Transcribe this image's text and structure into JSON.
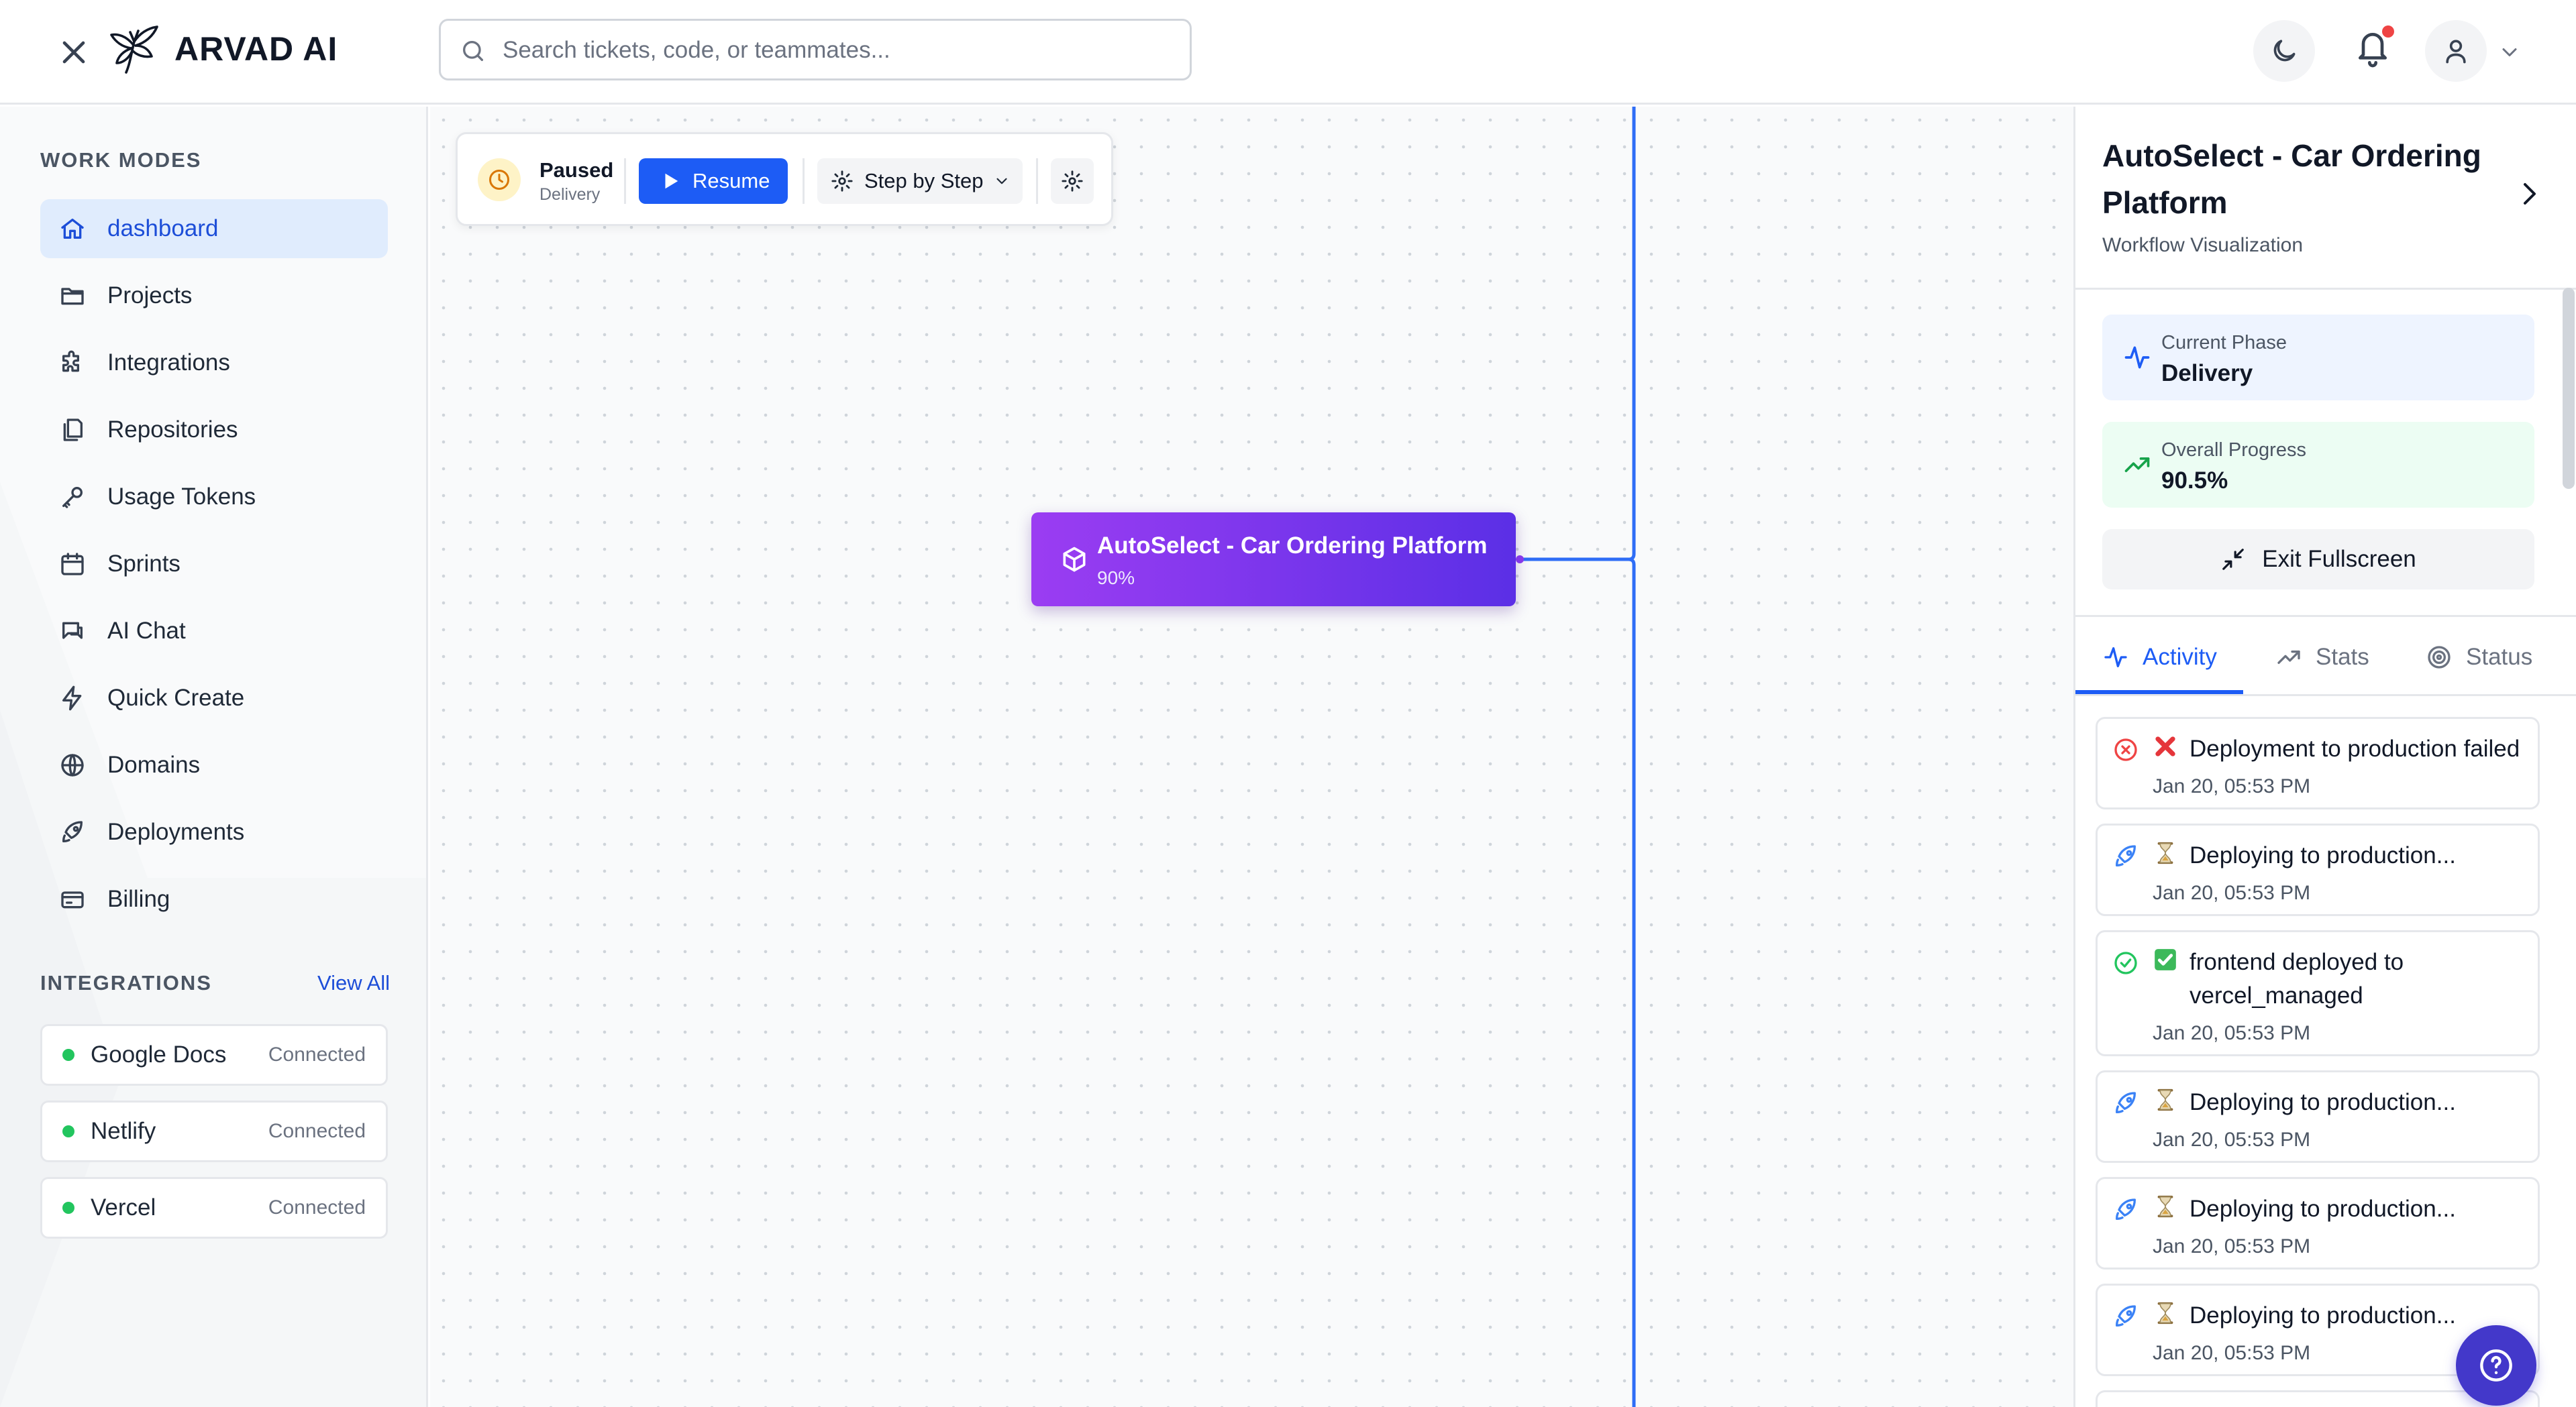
{
  "header": {
    "brand": "ARVAD AI",
    "search_placeholder": "Search tickets, code, or teammates..."
  },
  "sidebar": {
    "work_modes_title": "WORK MODES",
    "items": [
      {
        "label": "dashboard",
        "icon": "home-icon",
        "active": true
      },
      {
        "label": "Projects",
        "icon": "folder-icon"
      },
      {
        "label": "Integrations",
        "icon": "puzzle-icon"
      },
      {
        "label": "Repositories",
        "icon": "files-icon"
      },
      {
        "label": "Usage Tokens",
        "icon": "key-icon"
      },
      {
        "label": "Sprints",
        "icon": "calendar-icon"
      },
      {
        "label": "AI Chat",
        "icon": "chat-icon"
      },
      {
        "label": "Quick Create",
        "icon": "bolt-icon"
      },
      {
        "label": "Domains",
        "icon": "globe-icon"
      },
      {
        "label": "Deployments",
        "icon": "rocket-icon"
      },
      {
        "label": "Billing",
        "icon": "credit-card-icon"
      }
    ],
    "integrations_title": "INTEGRATIONS",
    "view_all": "View All",
    "integrations": [
      {
        "name": "Google Docs",
        "status": "Connected"
      },
      {
        "name": "Netlify",
        "status": "Connected"
      },
      {
        "name": "Vercel",
        "status": "Connected"
      }
    ]
  },
  "toolbar": {
    "state": "Paused",
    "phase": "Delivery",
    "resume_label": "Resume",
    "mode_label": "Step by Step"
  },
  "node": {
    "title": "AutoSelect - Car Ordering Platform",
    "progress": "90%"
  },
  "panel": {
    "title": "AutoSelect - Car Ordering Platform",
    "subtitle": "Workflow Visualization",
    "current_phase_label": "Current Phase",
    "current_phase_value": "Delivery",
    "overall_progress_label": "Overall Progress",
    "overall_progress_value": "90.5%",
    "exit_label": "Exit Fullscreen",
    "tabs": [
      {
        "label": "Activity",
        "icon": "activity-icon",
        "active": true
      },
      {
        "label": "Stats",
        "icon": "trending-up-icon"
      },
      {
        "label": "Status",
        "icon": "target-icon"
      }
    ],
    "activity": [
      {
        "text": "Deployment to production failed",
        "time": "Jan 20, 05:53 PM",
        "kind": "error",
        "emoji": "cross-mark-icon"
      },
      {
        "text": "Deploying to production...",
        "time": "Jan 20, 05:53 PM",
        "kind": "deploy",
        "emoji": "hourglass-icon"
      },
      {
        "text": "frontend deployed to vercel_managed",
        "time": "Jan 20, 05:53 PM",
        "kind": "success",
        "emoji": "check-box-icon"
      },
      {
        "text": "Deploying to production...",
        "time": "Jan 20, 05:53 PM",
        "kind": "deploy",
        "emoji": "hourglass-icon"
      },
      {
        "text": "Deploying to production...",
        "time": "Jan 20, 05:53 PM",
        "kind": "deploy",
        "emoji": "hourglass-icon"
      },
      {
        "text": "Deploying to production...",
        "time": "Jan 20, 05:53 PM",
        "kind": "deploy",
        "emoji": "hourglass-icon"
      }
    ]
  },
  "colors": {
    "accent": "#1d5cf5",
    "node_gradient_start": "#9b3df2",
    "node_gradient_end": "#5b2fe6",
    "success": "#22c55e",
    "error": "#ef4444"
  }
}
